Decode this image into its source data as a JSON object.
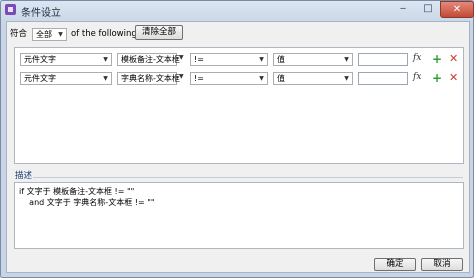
{
  "window": {
    "title": "条件设立",
    "minimize": "‒",
    "maximize": "□",
    "close": "✕"
  },
  "header": {
    "match_label": "符合",
    "match_value": "全部",
    "match_suffix": "of the following:",
    "clear_button": "清除全部"
  },
  "conditions": [
    {
      "type": "元件文字",
      "field": "模板备注-文本框",
      "operator": "!=",
      "value_type": "值",
      "value": "",
      "fx": "fx",
      "add": "+",
      "remove": "✕"
    },
    {
      "type": "元件文字",
      "field": "字典名称-文本框",
      "operator": "!=",
      "value_type": "值",
      "value": "",
      "fx": "fx",
      "add": "+",
      "remove": "✕"
    }
  ],
  "description": {
    "label": "描述",
    "line1": "if 文字于 模板备注-文本框 != \"\"",
    "line2": "    and 文字于 字典名称-文本框 != \"\""
  },
  "footer": {
    "ok": "确定",
    "cancel": "取消"
  },
  "colors": {
    "add": "#2fa02f",
    "remove": "#d23a2c",
    "close_button": "#c34a37",
    "app_icon": "#7b4bb5"
  },
  "icons": [
    "app-icon",
    "dropdown-arrow-icon",
    "fx-icon",
    "add-icon",
    "delete-icon"
  ]
}
